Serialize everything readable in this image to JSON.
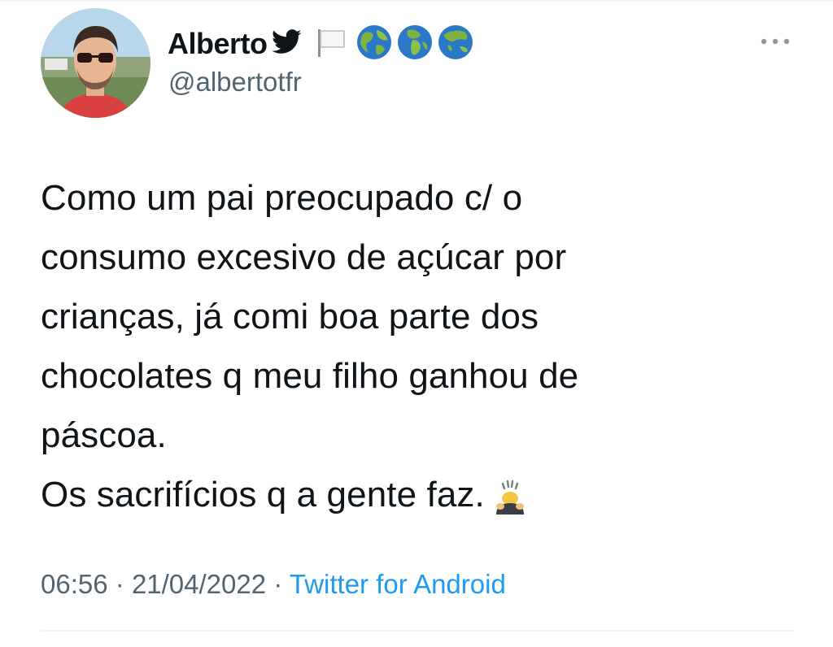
{
  "tweet": {
    "author": {
      "display_name": "Alberto",
      "handle": "@albertotfr",
      "name_emojis": [
        "bird-icon",
        "white-flag-icon",
        "globe-icon",
        "globe-icon",
        "globe-icon"
      ]
    },
    "text_lines": [
      "Como um pai preocupado c/ o",
      "consumo excesivo de açúcar por",
      "crianças, já comi boa parte dos",
      "chocolates q meu filho ganhou de",
      "páscoa.",
      "Os sacrifícios q a gente faz."
    ],
    "trailing_emoji": "person-bowing-icon",
    "time": "06:56",
    "separator": "·",
    "date": "21/04/2022",
    "source": "Twitter for Android"
  },
  "colors": {
    "text": "#0f1419",
    "secondary": "#536471",
    "link": "#1d9bf0",
    "divider": "#eff3f4"
  }
}
